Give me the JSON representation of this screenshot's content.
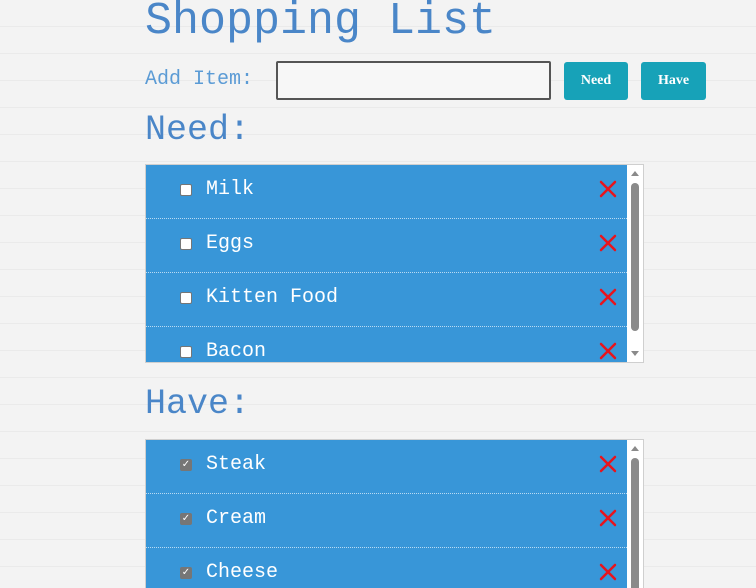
{
  "page": {
    "title": "Shopping List"
  },
  "add_form": {
    "label": "Add Item:",
    "input_value": "",
    "need_button": "Need",
    "have_button": "Have"
  },
  "need_section": {
    "heading": "Need:",
    "items": [
      {
        "label": "Milk",
        "checked": false
      },
      {
        "label": "Eggs",
        "checked": false
      },
      {
        "label": "Kitten Food",
        "checked": false
      },
      {
        "label": "Bacon",
        "checked": false
      }
    ]
  },
  "have_section": {
    "heading": "Have:",
    "items": [
      {
        "label": "Steak",
        "checked": true
      },
      {
        "label": "Cream",
        "checked": true
      },
      {
        "label": "Cheese",
        "checked": true
      }
    ]
  },
  "icons": {
    "delete": "close-icon",
    "checkbox": "checkbox-icon"
  },
  "colors": {
    "title": "#4a86c8",
    "item_background": "#3896d8",
    "button": "#17a2b8",
    "delete": "#e8141d"
  }
}
